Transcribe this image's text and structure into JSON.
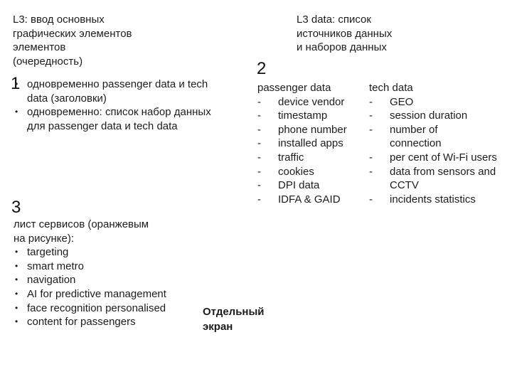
{
  "section1": {
    "title_lines": [
      "L3: ввод основных",
      "графических элементов",
      "элементов",
      "(очередность)"
    ],
    "number": "1",
    "items": [
      "одновременно passenger data и tech data (заголовки)",
      "одновременно: список набор данных для passenger data и tech data"
    ]
  },
  "section2": {
    "title_lines": [
      "L3 data: список",
      "источников данных",
      "и  наборов данных"
    ],
    "number": "2",
    "passenger": {
      "heading": "passenger data",
      "items": [
        "device vendor",
        "timestamp",
        "phone number",
        "installed apps",
        "traffic",
        "cookies",
        "DPI data",
        "IDFA & GAID"
      ]
    },
    "tech": {
      "heading": "tech data",
      "items": [
        "GEO",
        "session duration",
        "number of connection",
        "per cent of Wi-Fi users",
        "data from sensors and CCTV",
        "incidents statistics"
      ]
    },
    "dash": "-"
  },
  "section3": {
    "number": "3",
    "intro_lines": [
      "лист сервисов (оранжевым",
      "на  рисунке):"
    ],
    "items": [
      "targeting",
      "smart metro",
      "navigation",
      "AI for predictive management",
      "face recognition  personalised",
      "content for  passengers"
    ],
    "bullet": "•"
  },
  "note": {
    "lines": [
      "Отдельный",
      "экран"
    ]
  }
}
